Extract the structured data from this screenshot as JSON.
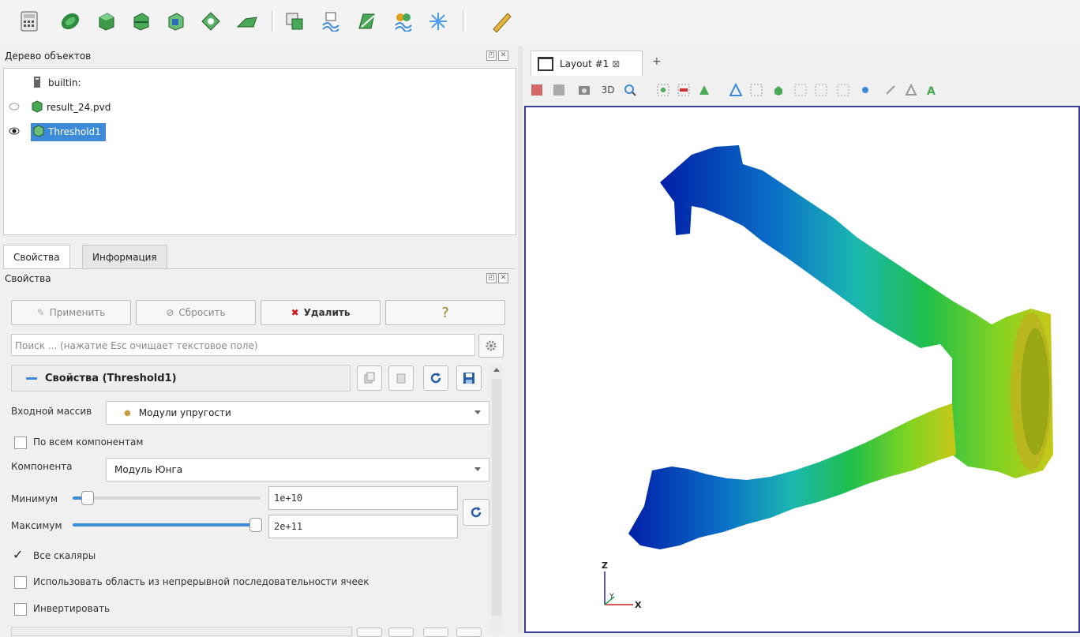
{
  "toolbar": {
    "icons": [
      "calculator-icon",
      "contour-icon",
      "clip-icon",
      "slice-icon",
      "threshold-icon",
      "extract-subset-icon",
      "glyph-icon",
      "stream-tracer-icon",
      "warp-icon",
      "group-datasets-icon",
      "extract-level-icon",
      "filter-icon",
      "ruler-icon"
    ]
  },
  "pipeline": {
    "title": "Дерево объектов",
    "items": [
      {
        "label": "builtin:"
      },
      {
        "label": "result_24.pvd"
      },
      {
        "label": "Threshold1"
      }
    ]
  },
  "tabs": [
    {
      "label": "Свойства"
    },
    {
      "label": "Информация"
    }
  ],
  "properties": {
    "title": "Свойства",
    "apply_label": "Применить",
    "reset_label": "Сбросить",
    "delete_label": "Удалить",
    "help_label": "?",
    "search_placeholder": "Поиск ... (нажатие Esc очищает текстовое поле)",
    "section_title": "Свойства (Threshold1)",
    "input_array_label": "Входной массив",
    "input_array_value": "Модули упругости",
    "all_components_label": "По всем компонентам",
    "component_label": "Компонента",
    "component_value": "Модуль Юнга",
    "min_label": "Минимум",
    "min_value": "1e+10",
    "min_slider_fraction": 0.05,
    "max_label": "Максимум",
    "max_value": "2e+11",
    "max_slider_fraction": 1.0,
    "all_scalars_label": "Все скаляры",
    "all_scalars_checked": "✓",
    "continuous_range_label": "Использовать область из непрерывной последовательности ячеек",
    "invert_label": "Инвертировать"
  },
  "view": {
    "tab_label": "Layout #1",
    "close_symbol": "⊠",
    "add_tab": "+",
    "mode_3d": "3D",
    "axis_z": "Z",
    "axis_y": "Y",
    "axis_x": "X"
  },
  "colors": {
    "selection": "#3c8ad8",
    "viewport_border": "#3b3b9a"
  }
}
